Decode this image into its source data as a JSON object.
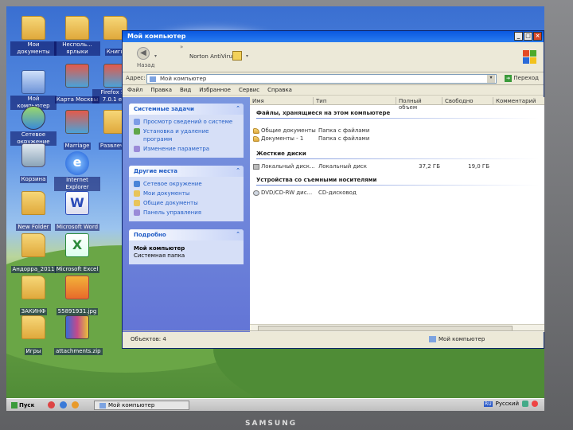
{
  "desktop_icons": [
    {
      "label": "Мои документы",
      "type": "folder"
    },
    {
      "label": "Несполь... ярлыки",
      "type": "folder"
    },
    {
      "label": "Книги",
      "type": "folder"
    },
    {
      "label": "Мой компьютер",
      "type": "computer"
    },
    {
      "label": "Карта Москвы",
      "type": "app"
    },
    {
      "label": "Firefox Set 7.0.1 exe",
      "type": "app"
    },
    {
      "label": "Сетевое окружение",
      "type": "network"
    },
    {
      "label": "Marriage",
      "type": "app"
    },
    {
      "label": "Развлечен",
      "type": "folder"
    },
    {
      "label": "Корзина",
      "type": "trash"
    },
    {
      "label": "Internet Explorer",
      "type": "ie"
    },
    {
      "label": "New Folder",
      "type": "folder"
    },
    {
      "label": "Microsoft Word",
      "type": "word"
    },
    {
      "label": "Андорра_2011",
      "type": "folder"
    },
    {
      "label": "Microsoft Excel",
      "type": "excel"
    },
    {
      "label": "ЗАКИНФ",
      "type": "folder"
    },
    {
      "label": "55891931.jpg",
      "type": "image"
    },
    {
      "label": "Игры",
      "type": "folder"
    },
    {
      "label": "attachments.zip",
      "type": "zip"
    }
  ],
  "window": {
    "title": "Мой компьютер",
    "toolbar": {
      "back_label": "Назад",
      "norton_label": "Norton AntiVirus"
    },
    "address": {
      "label": "Адрес:",
      "value": "Мой компьютер",
      "go_label": "Переход"
    },
    "menu": [
      "Файл",
      "Правка",
      "Вид",
      "Избранное",
      "Сервис",
      "Справка"
    ],
    "left_pane": {
      "system_tasks": {
        "header": "Системные задачи",
        "items": [
          "Просмотр сведений о системе",
          "Установка и удаление программ",
          "Изменение параметра"
        ]
      },
      "other_places": {
        "header": "Другие места",
        "items": [
          "Сетевое окружение",
          "Мои документы",
          "Общие документы",
          "Панель управления"
        ]
      },
      "details": {
        "header": "Подробно",
        "name": "Мой компьютер",
        "desc": "Системная папка"
      }
    },
    "columns": [
      "Имя",
      "Тип",
      "Полный объем",
      "Свободно",
      "Комментарий"
    ],
    "groups": [
      {
        "header": "Файлы, хранящиеся на этом компьютере",
        "items": [
          {
            "name": "Общие документы",
            "type": "Папка с файлами",
            "total": "",
            "free": ""
          },
          {
            "name": "Документы - 1",
            "type": "Папка с файлами",
            "total": "",
            "free": ""
          }
        ]
      },
      {
        "header": "Жесткие диски",
        "items": [
          {
            "name": "Локальный диск...",
            "type": "Локальный диск",
            "total": "37,2 ГБ",
            "free": "19,0 ГБ"
          }
        ]
      },
      {
        "header": "Устройства со съемными носителями",
        "items": [
          {
            "name": "DVD/CD-RW дис...",
            "type": "CD-дисковод",
            "total": "",
            "free": ""
          }
        ]
      }
    ],
    "status": {
      "objects": "Объектов: 4",
      "location": "Мой компьютер"
    }
  },
  "taskbar": {
    "start_label": "Пуск",
    "task_label": "Мой компьютер",
    "language": "Русский",
    "lang_code": "RU"
  },
  "monitor_brand": "SAMSUNG"
}
